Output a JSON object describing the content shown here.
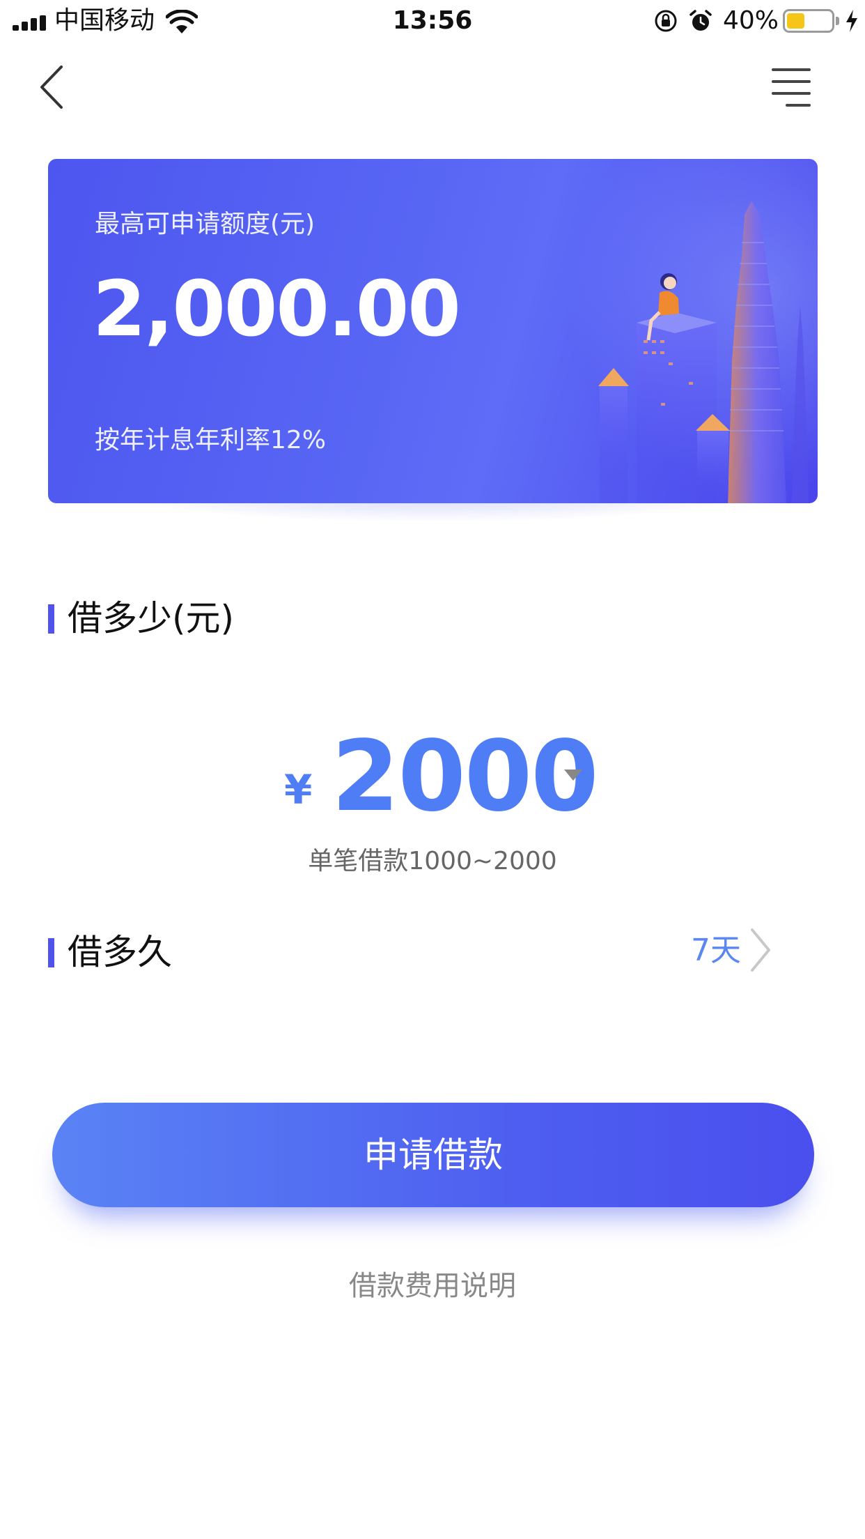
{
  "status_bar": {
    "carrier": "中国移动",
    "time": "13:56",
    "battery_percent": "40%",
    "battery_level": 0.4
  },
  "nav": {
    "back_icon": "chevron-left-icon",
    "menu_icon": "menu-icon"
  },
  "card": {
    "label": "最高可申请额度(元)",
    "amount": "2,000.00",
    "rate_text": "按年计息年利率12%"
  },
  "borrow_amount": {
    "title": "借多少(元)",
    "currency_symbol": "¥",
    "value": "2000",
    "range_text": "单笔借款1000~2000"
  },
  "borrow_term": {
    "title": "借多久",
    "value": "7天"
  },
  "actions": {
    "apply_label": "申请借款",
    "fee_link": "借款费用说明"
  },
  "colors": {
    "accent": "#4f7df5",
    "card_gradient_start": "#4d56ef",
    "card_gradient_end": "#4a45ec",
    "section_marker": "#4f53ec",
    "battery": "#f5c518"
  }
}
